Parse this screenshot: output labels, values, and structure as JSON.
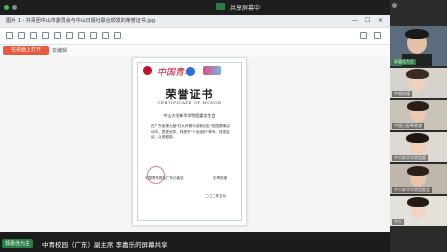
{
  "meeting": {
    "share_status": "共享屏幕中",
    "speaker_chip": "郭嘉佳为主",
    "speaker_text": "中青校园（广东）副主席 李嘉乐的屏幕共享"
  },
  "window": {
    "title": "图片 1 - 共青团中山市委员会与中山日报社联合颁发的荣誉证书.jpg",
    "controls": [
      "—",
      "☐",
      "✕"
    ],
    "primary_button": "在桌面上打开",
    "secondary_link": "去编辑"
  },
  "certificate": {
    "logo_text": "中国青年",
    "title": "荣誉证书",
    "subtitle": "CERTIFICATE OF HONOR",
    "recipient": "中山大学新华学院团委学生会",
    "body": "在广东省第九届\"红九杯赛与创新创业\"校园赛事活动中，表现优异，特授予\"十佳组织\"称号。特发此证，以资鼓励。",
    "issuer": "中国青年报社广东记者站",
    "issuer2": "中青校媒",
    "date": "二〇二年五月"
  },
  "participants": [
    {
      "name": "郭嘉佳为主",
      "active": true
    },
    {
      "name": "中青校媒",
      "active": false
    },
    {
      "name": "中国日报粤港澳",
      "active": false
    },
    {
      "name": "中大新华学院团委",
      "active": false
    },
    {
      "name": "中大新华学院团委会",
      "active": false
    },
    {
      "name": "中大",
      "active": false
    }
  ],
  "colors": {
    "accent_red": "#c8102e",
    "active_green": "#2d7d46",
    "button_orange": "#e85a3d"
  }
}
